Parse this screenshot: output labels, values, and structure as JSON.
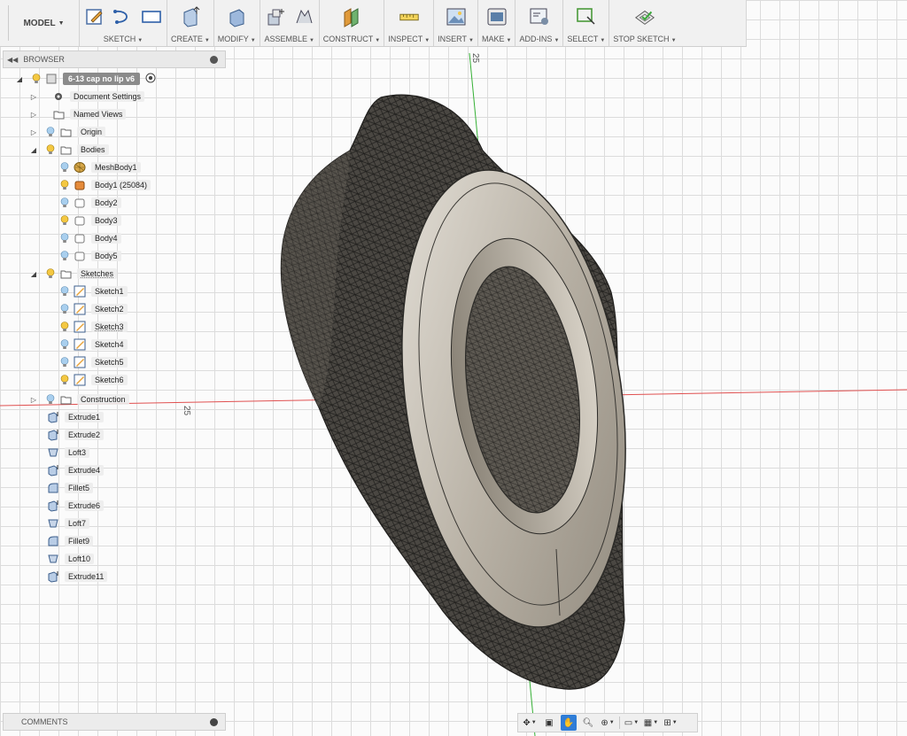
{
  "toolbar": {
    "workspace": "MODEL",
    "groups": [
      {
        "label": "SKETCH"
      },
      {
        "label": "CREATE"
      },
      {
        "label": "MODIFY"
      },
      {
        "label": "ASSEMBLE"
      },
      {
        "label": "CONSTRUCT"
      },
      {
        "label": "INSPECT"
      },
      {
        "label": "INSERT"
      },
      {
        "label": "MAKE"
      },
      {
        "label": "ADD-INS"
      },
      {
        "label": "SELECT"
      },
      {
        "label": "STOP SKETCH"
      }
    ]
  },
  "browser": {
    "title": "BROWSER",
    "root": "6-13 cap no lip v6",
    "items": [
      {
        "label": "Document Settings",
        "icon": "gear-icon"
      },
      {
        "label": "Named Views",
        "icon": "folder-icon"
      },
      {
        "label": "Origin",
        "icon": "folder-icon"
      },
      {
        "label": "Bodies",
        "icon": "folder-icon"
      },
      {
        "label": "MeshBody1",
        "icon": "mesh-body-icon"
      },
      {
        "label": "Body1 (25084)",
        "icon": "body-icon"
      },
      {
        "label": "Body2",
        "icon": "body-outline-icon"
      },
      {
        "label": "Body3",
        "icon": "body-outline-icon"
      },
      {
        "label": "Body4",
        "icon": "body-outline-icon"
      },
      {
        "label": "Body5",
        "icon": "body-outline-icon"
      },
      {
        "label": "Sketches",
        "icon": "folder-icon"
      },
      {
        "label": "Sketch1",
        "icon": "sketch-icon"
      },
      {
        "label": "Sketch2",
        "icon": "sketch-icon"
      },
      {
        "label": "Sketch3",
        "icon": "sketch-icon"
      },
      {
        "label": "Sketch4",
        "icon": "sketch-icon"
      },
      {
        "label": "Sketch5",
        "icon": "sketch-icon"
      },
      {
        "label": "Sketch6",
        "icon": "sketch-icon"
      },
      {
        "label": "Construction",
        "icon": "folder-icon"
      }
    ]
  },
  "timeline": [
    {
      "label": "Extrude1",
      "icon": "extrude-icon"
    },
    {
      "label": "Extrude2",
      "icon": "extrude-icon"
    },
    {
      "label": "Loft3",
      "icon": "loft-icon"
    },
    {
      "label": "Extrude4",
      "icon": "extrude-icon"
    },
    {
      "label": "Fillet5",
      "icon": "fillet-icon"
    },
    {
      "label": "Extrude6",
      "icon": "extrude-icon"
    },
    {
      "label": "Loft7",
      "icon": "loft-icon"
    },
    {
      "label": "Fillet9",
      "icon": "fillet-icon"
    },
    {
      "label": "Loft10",
      "icon": "loft-icon"
    },
    {
      "label": "Extrude11",
      "icon": "extrude-icon"
    }
  ],
  "viewport": {
    "axis_label_top": "25",
    "axis_label_left": "25"
  },
  "comments": {
    "title": "COMMENTS"
  },
  "colors": {
    "accent": "#2f7dd7",
    "mesh_dark": "#3a3834",
    "body_face": "#c9c2b6",
    "axis_red": "#e05050",
    "axis_green": "#35b035"
  }
}
